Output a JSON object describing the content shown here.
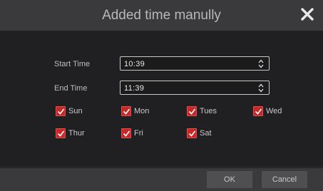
{
  "dialog": {
    "title": "Added time manully",
    "close_icon": "close-icon"
  },
  "start_time": {
    "label": "Start Time",
    "value": "10:39"
  },
  "end_time": {
    "label": "End Time",
    "value": "11:39"
  },
  "days": [
    {
      "label": "Sun",
      "checked": true
    },
    {
      "label": "Mon",
      "checked": true
    },
    {
      "label": "Tues",
      "checked": true
    },
    {
      "label": "Wed",
      "checked": true
    },
    {
      "label": "Thur",
      "checked": true
    },
    {
      "label": "Fri",
      "checked": true
    },
    {
      "label": "Sat",
      "checked": true
    }
  ],
  "buttons": {
    "ok": "OK",
    "cancel": "Cancel"
  },
  "colors": {
    "checkbox": "#c62828",
    "titlebar": "#3a3a3c",
    "body": "#202022"
  }
}
